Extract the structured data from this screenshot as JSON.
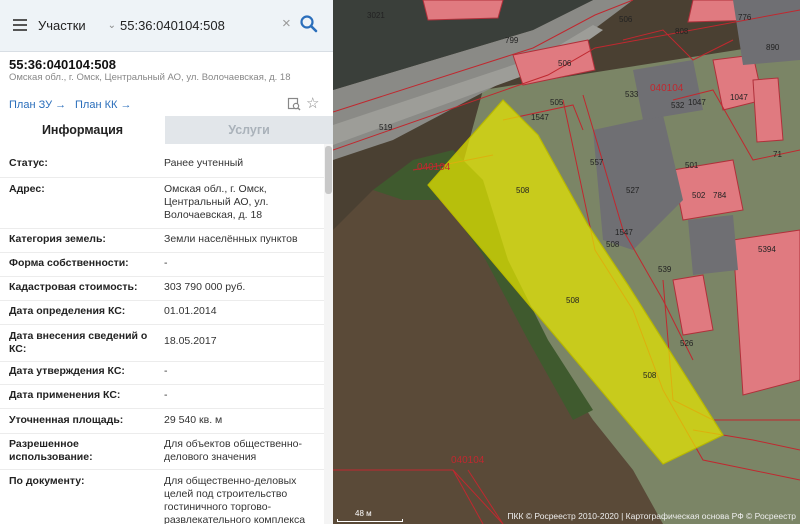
{
  "search": {
    "category": "Участки",
    "value": "55:36:040104:508"
  },
  "card": {
    "title": "55:36:040104:508",
    "address": "Омская обл., г. Омск, Центральный АО, ул. Волочаевская, д. 18",
    "plan_zu": "План ЗУ",
    "plan_kk": "План КК"
  },
  "tabs": {
    "info": "Информация",
    "services": "Услуги"
  },
  "info": [
    {
      "label": "Статус:",
      "value": "Ранее учтенный"
    },
    {
      "label": "Адрес:",
      "value": "Омская обл., г. Омск, Центральный АО, ул. Волочаевская, д. 18"
    },
    {
      "label": "Категория земель:",
      "value": "Земли населённых пунктов"
    },
    {
      "label": "Форма собственности:",
      "value": "-"
    },
    {
      "label": "Кадастровая стоимость:",
      "value": "303 790 000 руб."
    },
    {
      "label": "Дата определения КС:",
      "value": "01.01.2014"
    },
    {
      "label": "Дата внесения сведений о КС:",
      "value": "18.05.2017"
    },
    {
      "label": "Дата утверждения КС:",
      "value": "-"
    },
    {
      "label": "Дата применения КС:",
      "value": "-"
    },
    {
      "label": "Уточненная площадь:",
      "value": "29 540 кв. м"
    },
    {
      "label": "Разрешенное использование:",
      "value": "Для объектов общественно-делового значения"
    },
    {
      "label": "По документу:",
      "value": "Для общественно-деловых целей под строительство гостиничного торгово-развлекательного комплекса"
    }
  ],
  "map": {
    "quarter_labels": [
      "040104",
      "040104",
      "040104"
    ],
    "plot_labels": [
      "3021",
      "506",
      "808",
      "776",
      "890",
      "799",
      "506",
      "533",
      "532",
      "505",
      "1547",
      "1047",
      "508",
      "508",
      "508",
      "508",
      "519",
      "557",
      "527",
      "501",
      "502",
      "784",
      "71",
      "5394",
      "539",
      "526",
      "1547",
      "1047"
    ],
    "scale_label": "48 м",
    "footer": "ПКК © Росреестр 2010-2020 | Картографическая основа РФ © Росреестр"
  },
  "colors": {
    "accent": "#2a6ebb",
    "selected_plot_fill": "#e6e600",
    "boundary": "#c0282f"
  }
}
